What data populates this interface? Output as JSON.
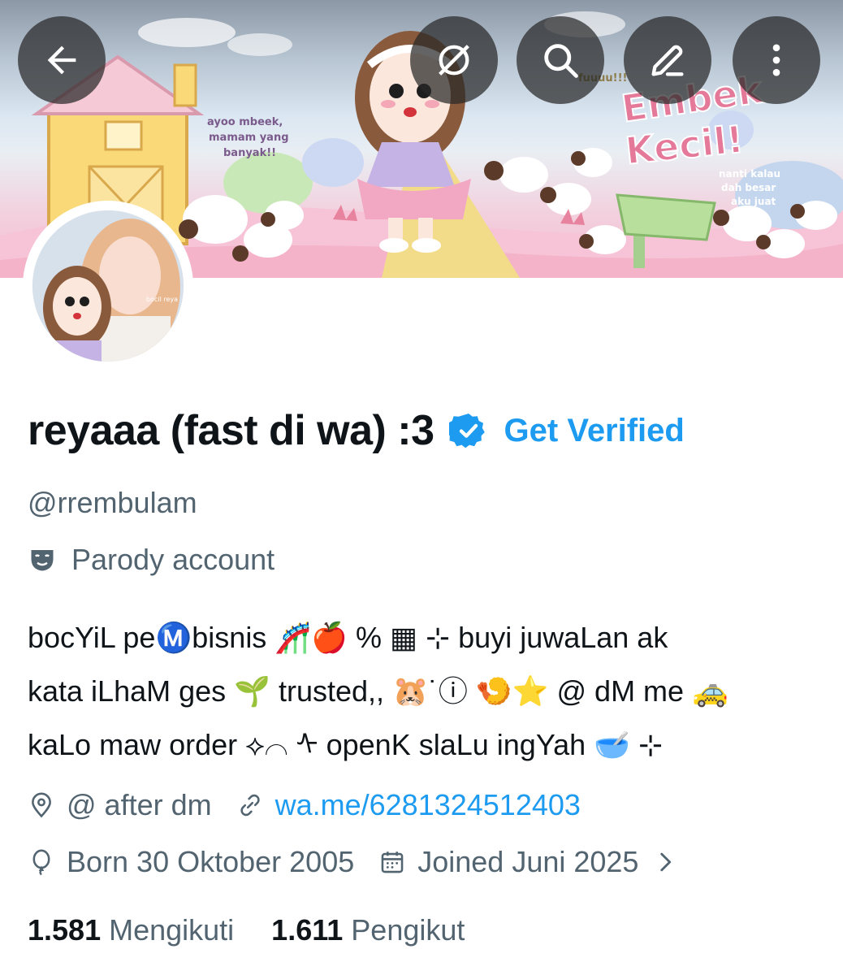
{
  "banner": {
    "stickers": {
      "bubble_left": [
        "ayoo mbeek,",
        "mamam yang",
        "banyak!!"
      ],
      "title": [
        "Embek",
        "Kecil!"
      ],
      "note_right": [
        "nanti kalau",
        "dah besar",
        "aku juat"
      ],
      "shout": "fuuuu!!!"
    },
    "avatar_sticker": "bocil\nreya"
  },
  "header": {
    "back_icon": "arrow-left-icon",
    "translate_icon": "mute-ring-icon",
    "search_icon": "search-icon",
    "edit_icon": "pencil-icon",
    "more_icon": "more-vertical-icon"
  },
  "profile": {
    "display_name": "reyaaa (fast di wa) :3",
    "get_verified": "Get Verified",
    "handle": "@rrembulam",
    "parody_label": "Parody account",
    "bio_lines": [
      "bocYiL peⓂ️bisnis 🎢🍎 % ▦ ⊹ buyi juwaLan ak",
      "kata iLhaM ges 🌱 trusted,, 🐹˙ⓘ 🍤⭐ @ dM me 🚕",
      "kaLo maw order ⟡⌒ ᠰ openK slaLu ingYah 🥣 ⊹"
    ],
    "location": "@ after dm",
    "website": "wa.me/6281324512403",
    "born": "Born 30 Oktober 2005",
    "joined": "Joined Juni 2025"
  },
  "stats": {
    "following_count": "1.581",
    "following_label": "Mengikuti",
    "followers_count": "1.611",
    "followers_label": "Pengikut"
  },
  "colors": {
    "accent": "#1d9bf0",
    "secondary_text": "#536471",
    "primary_text": "#0f1419"
  }
}
